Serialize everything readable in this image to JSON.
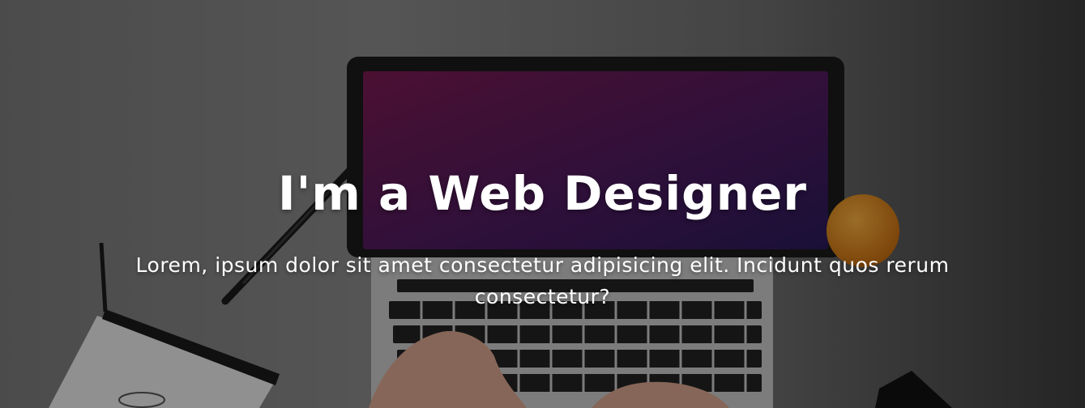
{
  "hero": {
    "headline": "I'm a Web Designer",
    "subtitle": "Lorem, ipsum dolor sit amet consectetur adipisicing elit. Incidunt quos rerum consectetur?"
  },
  "colors": {
    "text": "#ffffff",
    "screen_gradient_start": "#7a1a52",
    "screen_gradient_end": "#3a1a6e",
    "orange": "#e8901c"
  }
}
